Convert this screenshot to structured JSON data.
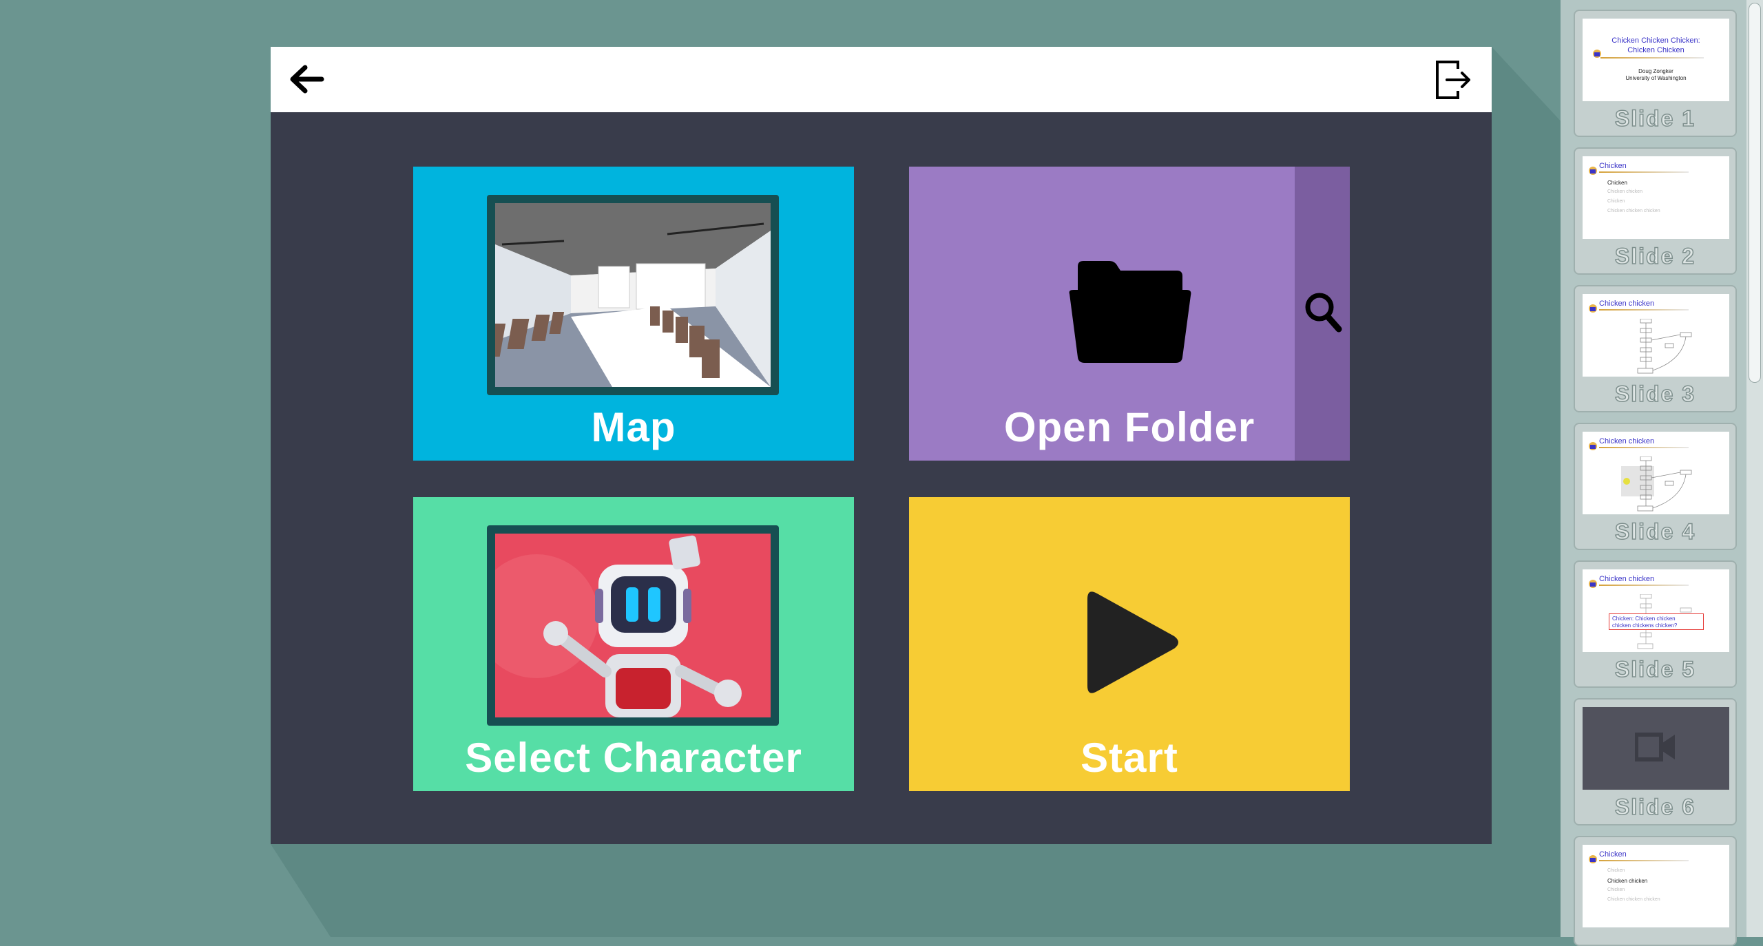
{
  "window": {
    "back_button_icon": "arrow-left-icon",
    "exit_button_icon": "exit-door-icon"
  },
  "tiles": {
    "map": {
      "label": "Map",
      "image": "conference-room-preview"
    },
    "folder": {
      "label": "Open Folder",
      "icon": "folder-icon",
      "side_icon": "search-icon"
    },
    "character": {
      "label": "Select Character",
      "image": "robot-character-preview"
    },
    "start": {
      "label": "Start",
      "icon": "play-icon"
    }
  },
  "colors": {
    "map_tile": "#00b4de",
    "folder_tile": "#9b7bc4",
    "character_tile": "#56dea6",
    "start_tile": "#f7cc34",
    "window_bg": "#393c4b",
    "desktop_bg": "#6b9590"
  },
  "slides": [
    {
      "label": "Slide 1",
      "title_lines": [
        "Chicken Chicken Chicken:",
        "Chicken Chicken"
      ],
      "author": "Doug Zongker",
      "affiliation": "University of Washington"
    },
    {
      "label": "Slide 2",
      "title": "Chicken",
      "bullet": "Chicken",
      "faint_lines": [
        "Chicken chicken",
        "Chicken",
        "Chicken chicken chicken"
      ]
    },
    {
      "label": "Slide 3",
      "title": "Chicken chicken"
    },
    {
      "label": "Slide 4",
      "title": "Chicken chicken"
    },
    {
      "label": "Slide 5",
      "title": "Chicken chicken",
      "callout_line1": "Chicken: Chicken chicken",
      "callout_line2": "chicken chickens chicken?"
    },
    {
      "label": "Slide 6",
      "icon": "video-camera-icon"
    },
    {
      "title": "Chicken",
      "bullet": "Chicken chicken",
      "faint_lines": [
        "Chicken",
        "Chicken",
        "Chicken chicken chicken"
      ]
    }
  ]
}
